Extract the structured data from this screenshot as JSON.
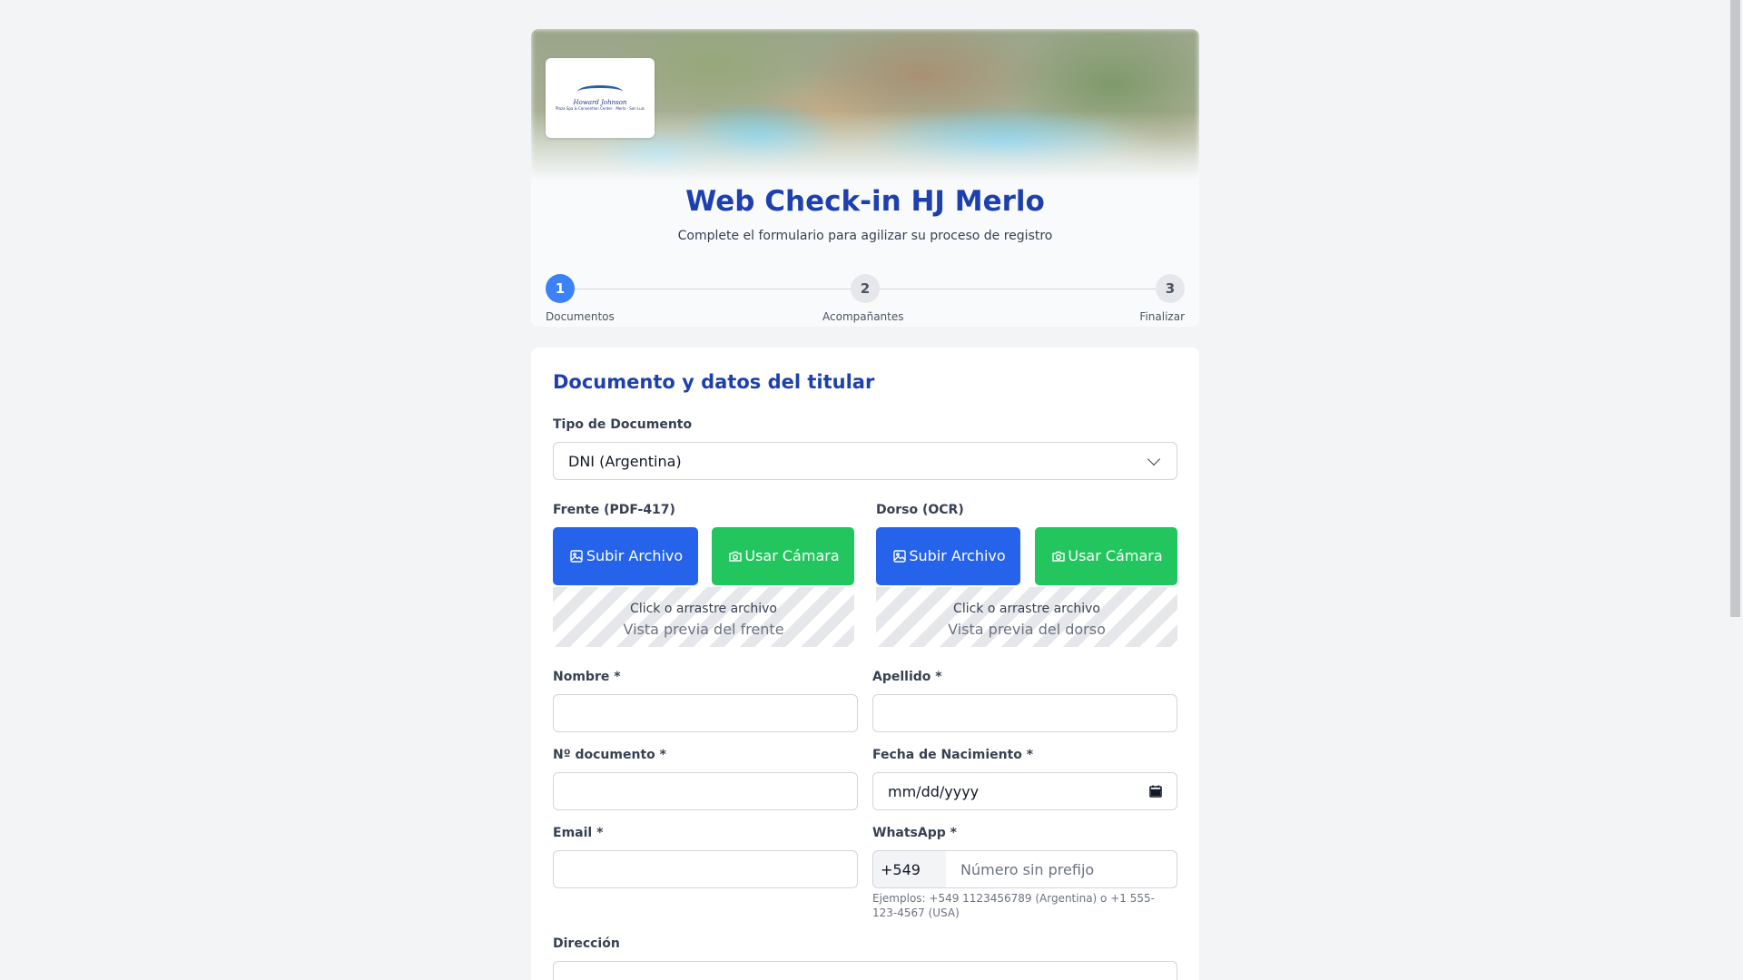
{
  "header": {
    "title": "Web Check-in HJ Merlo",
    "subtitle": "Complete el formulario para agilizar su proceso de registro",
    "logo": {
      "main_text": "Howard Johnson",
      "sub_text": "Plaza Spa & Convention Center · Merlo · San Luis"
    }
  },
  "stepper": {
    "steps": [
      {
        "number": "1",
        "label": "Documentos",
        "state": "active"
      },
      {
        "number": "2",
        "label": "Acompañantes",
        "state": "inactive"
      },
      {
        "number": "3",
        "label": "Finalizar",
        "state": "inactive"
      }
    ]
  },
  "form": {
    "section_title": "Documento y datos del titular",
    "doc_type": {
      "label": "Tipo de Documento",
      "selected": "DNI (Argentina)"
    },
    "front": {
      "label": "Frente (PDF-417)",
      "upload_button": "Subir Archivo",
      "camera_button": "Usar Cámara",
      "dropzone_text": "Click o arrastre archivo",
      "preview_text": "Vista previa del frente"
    },
    "back": {
      "label": "Dorso (OCR)",
      "upload_button": "Subir Archivo",
      "camera_button": "Usar Cámara",
      "dropzone_text": "Click o arrastre archivo",
      "preview_text": "Vista previa del dorso"
    },
    "nombre": {
      "label": "Nombre *",
      "value": ""
    },
    "apellido": {
      "label": "Apellido *",
      "value": ""
    },
    "documento": {
      "label": "Nº documento *",
      "value": ""
    },
    "fecha_nacimiento": {
      "label": "Fecha de Nacimiento *",
      "placeholder": "mm/dd/yyyy"
    },
    "email": {
      "label": "Email *",
      "value": ""
    },
    "whatsapp": {
      "label": "WhatsApp *",
      "prefix": "+549",
      "placeholder": "Número sin prefijo",
      "help": "Ejemplos: +549 1123456789 (Argentina) o +1 555-123-4567 (USA)"
    },
    "direccion": {
      "label": "Dirección"
    }
  },
  "colors": {
    "primary_blue": "#2563eb",
    "title_blue": "#1e40af",
    "green": "#22c55e",
    "step_active": "#3b82f6"
  },
  "icons": {
    "upload": "image-icon",
    "camera": "camera-icon",
    "dropdown": "chevron-down-icon",
    "date": "calendar-icon"
  }
}
